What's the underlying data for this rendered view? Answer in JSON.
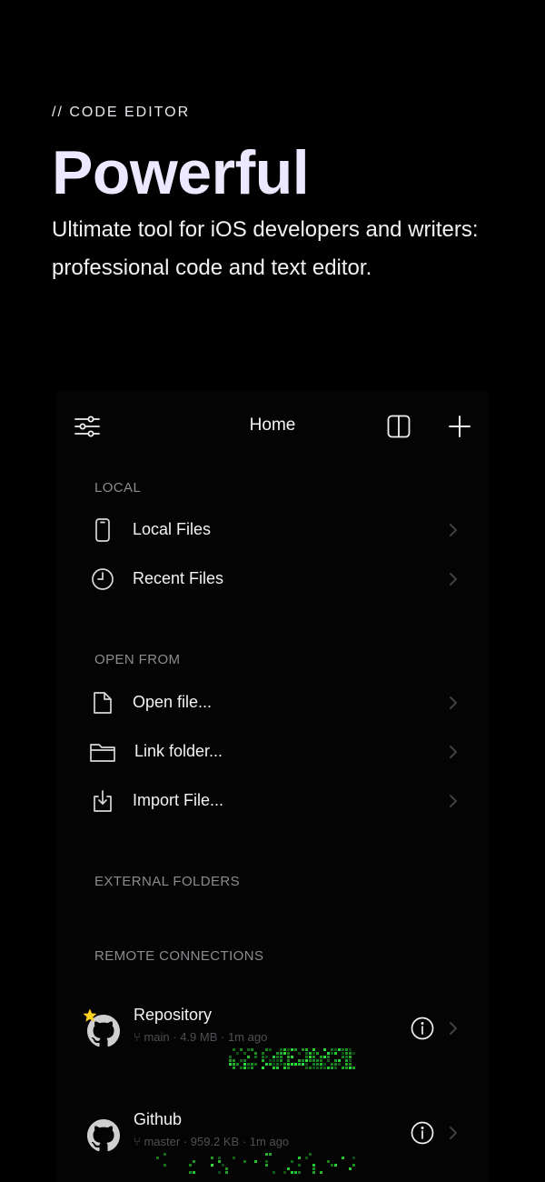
{
  "hero": {
    "eyebrow": "// CODE EDITOR",
    "headline": "Powerful",
    "subtitle": "Ultimate tool for iOS developers and writers: professional code and text editor."
  },
  "topbar": {
    "title": "Home",
    "left_icon": "sliders-icon",
    "split_icon": "split-view-icon",
    "add_icon": "plus-icon"
  },
  "sections": {
    "local": "LOCAL",
    "open_from": "OPEN FROM",
    "external_folders": "EXTERNAL FOLDERS",
    "remote_connections": "REMOTE CONNECTIONS"
  },
  "local_items": [
    {
      "label": "Local Files",
      "icon": "phone-icon"
    },
    {
      "label": "Recent Files",
      "icon": "clock-icon"
    }
  ],
  "open_from_items": [
    {
      "label": "Open file...",
      "icon": "document-icon"
    },
    {
      "label": "Link folder...",
      "icon": "folder-icon"
    },
    {
      "label": "Import File...",
      "icon": "import-icon"
    }
  ],
  "remotes": [
    {
      "name": "Repository",
      "branch": "main",
      "size": "4.9 MB",
      "time": "1m ago",
      "starred": true,
      "icon": "github-icon"
    },
    {
      "name": "Github",
      "branch": "master",
      "size": "959.2 KB",
      "time": "1m ago",
      "starred": false,
      "icon": "github-icon"
    }
  ],
  "colors": {
    "background": "#000000",
    "headline": "#ece8ff",
    "section_label": "#8b8b90",
    "activity_green": "#3ddc3d",
    "star": "#ffd21f"
  }
}
